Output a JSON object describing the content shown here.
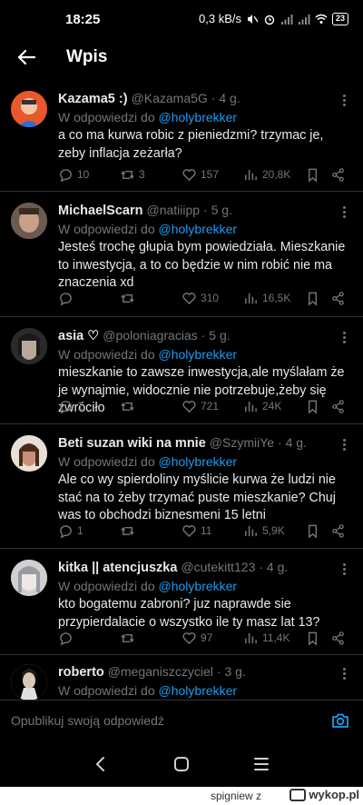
{
  "status_bar": {
    "time": "18:25",
    "network_speed": "0,3 kB/s",
    "battery": "23"
  },
  "header": {
    "title": "Wpis"
  },
  "tweets": [
    {
      "name": "Kazama5 :)",
      "handle": "@Kazama5G",
      "time": "· 4 g.",
      "reply_prefix": "W odpowiedzi do",
      "reply_to": "@holybrekker",
      "text": "a co ma kurwa robic z pieniedzmi? trzymac je, zeby inflacja zeżarła?",
      "replies": "10",
      "retweets": "3",
      "likes": "157",
      "views": "20,8K",
      "avatar_color": "#e8582a"
    },
    {
      "name": "MichaelScarn",
      "handle": "@natiiipp",
      "time": "· 5 g.",
      "reply_prefix": "W odpowiedzi do",
      "reply_to": "@holybrekker",
      "text": "Jesteś trochę głupia bym powiedziała. Mieszkanie to inwestycja, a to co będzie w nim robić nie ma znaczenia xd",
      "replies": "",
      "retweets": "",
      "likes": "310",
      "views": "16,5K",
      "avatar_color": "#8a6a58"
    },
    {
      "name": "asia ♡",
      "handle": "@poloniagracias",
      "time": "· 5 g.",
      "reply_prefix": "W odpowiedzi do",
      "reply_to": "@holybrekker",
      "text": "mieszkanie to zawsze inwestycja,ale myślałam że je wynajmie, widocznie nie potrzebuje,żeby się zwróciło",
      "replies": "1",
      "retweets": "",
      "likes": "721",
      "views": "24K",
      "avatar_color": "#3a3a3a"
    },
    {
      "name": "Beti suzan wiki na mnie",
      "handle": "@SzymiiYe",
      "time": "· 4 g.",
      "reply_prefix": "W odpowiedzi do",
      "reply_to": "@holybrekker",
      "text": "Ale co wy spierdoliny myślicie kurwa że ludzi nie stać na to żeby trzymać puste mieszkanie? Chuj was to obchodzi biznesmeni 15 letni",
      "replies": "1",
      "retweets": "",
      "likes": "11",
      "views": "5,9K",
      "avatar_color": "#b07a62"
    },
    {
      "name": "kitka || atencjuszka",
      "handle": "@cutekitt123",
      "time": "· 4 g.",
      "reply_prefix": "W odpowiedzi do",
      "reply_to": "@holybrekker",
      "text": "kto bogatemu zabroni? juz naprawde sie przypierdalacie o wszystko ile ty masz lat 13?",
      "replies": "",
      "retweets": "",
      "likes": "97",
      "views": "11,4K",
      "avatar_color": "#d8d8d8"
    },
    {
      "name": "roberto",
      "handle": "@meganiszczyciel",
      "time": "· 3 g.",
      "reply_prefix": "W odpowiedzi do",
      "reply_to": "@holybrekker",
      "text": "",
      "replies": "",
      "retweets": "",
      "likes": "",
      "views": "",
      "avatar_color": "#c8c8c8"
    }
  ],
  "composer": {
    "placeholder": "Opublikuj swoją odpowiedź"
  },
  "watermark": {
    "user": "spigniew z",
    "site": "wykop.pl"
  },
  "colors": {
    "background": "#000000",
    "text": "#e7e9ea",
    "muted": "#71767b",
    "accent": "#1d9bf0",
    "divider": "#2f3336"
  }
}
